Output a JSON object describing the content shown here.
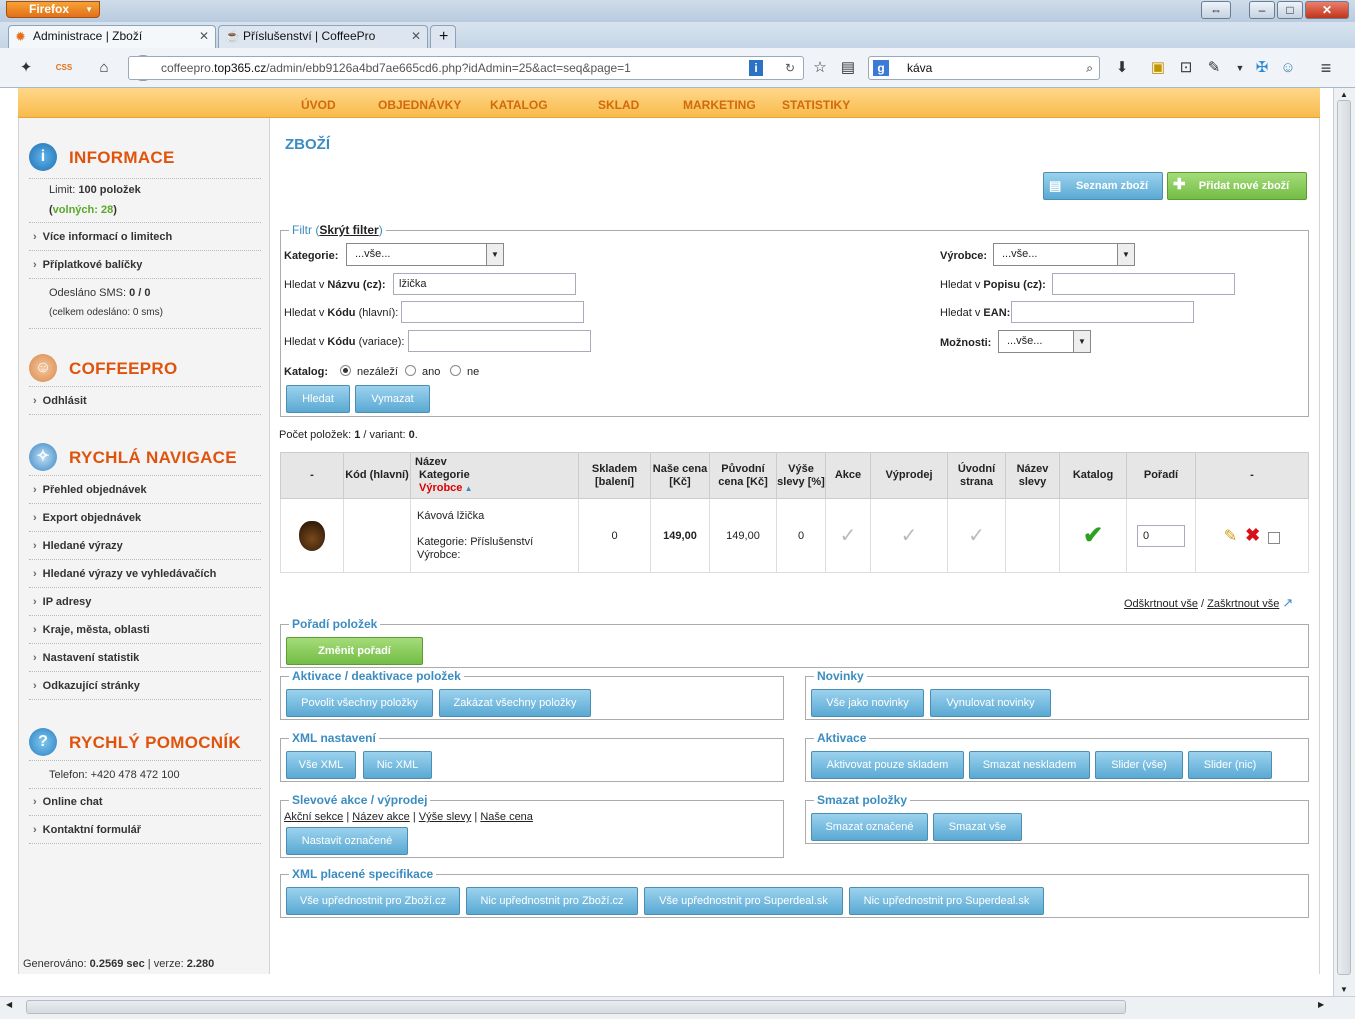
{
  "browser": {
    "app_label": "Firefox",
    "tabs": [
      {
        "label": "Administrace | Zboží",
        "active": true
      },
      {
        "label": "Příslušenství | CoffeePro",
        "active": false
      }
    ],
    "url_host": "coffeepro.",
    "url_domain": "top365.cz",
    "url_path": "/admin/ebb9126a4bd7ae665cd6.php?idAdmin=25&act=seq&page=1",
    "search_value": "káva"
  },
  "topmenu": [
    "ÚVOD",
    "OBJEDNÁVKY",
    "KATALOG",
    "SKLAD",
    "MARKETING",
    "STATISTIKY"
  ],
  "sidebar": {
    "info": {
      "title": "INFORMACE",
      "limit_label": "Limit:",
      "limit_value": "100 položek",
      "free_open": "(",
      "free_label": "volných:",
      "free_value": "28",
      "free_close": ")",
      "more_info": "Více informací o limitech",
      "packages": "Příplatkové balíčky",
      "sms_label": "Odesláno SMS:",
      "sms_value": "0 / 0",
      "sms_total": "(celkem odesláno: 0 sms)"
    },
    "shop": {
      "title": "COFFEEPRO",
      "logout": "Odhlásit"
    },
    "nav": {
      "title": "RYCHLÁ NAVIGACE",
      "items": [
        "Přehled objednávek",
        "Export objednávek",
        "Hledané výrazy",
        "Hledané výrazy ve vyhledávačích",
        "IP adresy",
        "Kraje, města, oblasti",
        "Nastavení statistik",
        "Odkazující stránky"
      ]
    },
    "help": {
      "title": "RYCHLÝ POMOCNÍK",
      "phone": "Telefon: +420 478 472 100",
      "chat": "Online chat",
      "form": "Kontaktní formulář"
    },
    "footer_label": "Generováno:",
    "footer_time": "0.2569 sec",
    "footer_sep": "| verze:",
    "footer_version": "2.280"
  },
  "main": {
    "title": "ZBOŽÍ",
    "list_button": "Seznam zboží",
    "add_button": "Přidat nové zboží"
  },
  "filter": {
    "legend_text": "Filtr (",
    "legend_link": "Skrýt filter",
    "legend_close": ")",
    "category_label": "Kategorie:",
    "category_value": "...vše...",
    "name_label_pre": "Hledat v ",
    "name_label_b": "Názvu",
    "name_label_post": " (cz):",
    "name_value": "lžička",
    "code_label_pre": "Hledat v ",
    "code_label_b": "Kódu",
    "code_label_post": " (hlavní):",
    "code_value": "",
    "variant_label_pre": "Hledat v ",
    "variant_label_b": "Kódu",
    "variant_label_post": " (variace):",
    "variant_value": "",
    "catalog_label": "Katalog:",
    "catalog_options": [
      "nezáleží",
      "ano",
      "ne"
    ],
    "maker_label": "Výrobce:",
    "maker_value": "...vše...",
    "desc_label_pre": "Hledat v ",
    "desc_label_b": "Popisu",
    "desc_label_post": " (cz):",
    "desc_value": "",
    "ean_label_pre": "Hledat v ",
    "ean_label_b": "EAN",
    "ean_label_post": ":",
    "ean_value": "",
    "options_label": "Možnosti:",
    "options_value": "...vše...",
    "search_button": "Hledat",
    "clear_button": "Vymazat"
  },
  "count": {
    "pre": "Počet položek: ",
    "items": "1",
    "mid": " / variant: ",
    "variants": "0",
    "post": "."
  },
  "table": {
    "headers": {
      "dash": "-",
      "code": "Kód (hlavní)",
      "name": "Název",
      "category": "Kategorie",
      "maker": "Výrobce",
      "stock": "Skladem [balení]",
      "price": "Naše cena [Kč]",
      "orig_price": "Původní cena [Kč]",
      "discount": "Výše slevy [%]",
      "sale": "Akce",
      "clearance": "Výprodej",
      "homepage": "Úvodní strana",
      "discount_name": "Název slevy",
      "catalog": "Katalog",
      "order": "Pořadí",
      "dash2": "-"
    },
    "rows": [
      {
        "name": "Kávová lžička",
        "category": "Kategorie: Příslušenství",
        "maker": "Výrobce:",
        "stock": "0",
        "price": "149,00",
        "orig_price": "149,00",
        "discount": "0",
        "order": "0"
      }
    ]
  },
  "check": {
    "uncheck_all": "Odškrtnout vše",
    "sep": "/",
    "check_all": "Zaškrtnout vše"
  },
  "order_box": {
    "legend": "Pořadí položek",
    "button": "Změnit pořadí"
  },
  "activation": {
    "legend": "Aktivace / deaktivace položek",
    "allow": "Povolit všechny položky",
    "deny": "Zakázat všechny položky"
  },
  "news": {
    "legend": "Novinky",
    "all": "Vše jako novinky",
    "reset": "Vynulovat novinky"
  },
  "xml": {
    "legend": "XML nastavení",
    "all": "Vše XML",
    "none": "Nic XML"
  },
  "activate": {
    "legend": "Aktivace",
    "stock": "Aktivovat pouze skladem",
    "delete_nostock": "Smazat neskladem",
    "slider_all": "Slider (vše)",
    "slider_none": "Slider (nic)"
  },
  "discounts": {
    "legend": "Slevové akce / výprodej",
    "links": [
      "Akční sekce",
      "Název akce",
      "Výše slevy",
      "Naše cena"
    ],
    "button": "Nastavit označené"
  },
  "delete": {
    "legend": "Smazat položky",
    "selected": "Smazat označené",
    "all": "Smazat vše"
  },
  "xmlpaid": {
    "legend": "XML placené specifikace",
    "b1": "Vše upřednostnit pro Zboží.cz",
    "b2": "Nic upřednostnit pro Zboží.cz",
    "b3": "Vše upřednostnit pro Superdeal.sk",
    "b4": "Nic upřednostnit pro Superdeal.sk"
  },
  "colors": {
    "accent": "#e0530d",
    "blue": "#3b8cc0",
    "button_blue": "#5aa9d3",
    "green": "#73bd45",
    "menu_orange": "#f8ba4b"
  }
}
